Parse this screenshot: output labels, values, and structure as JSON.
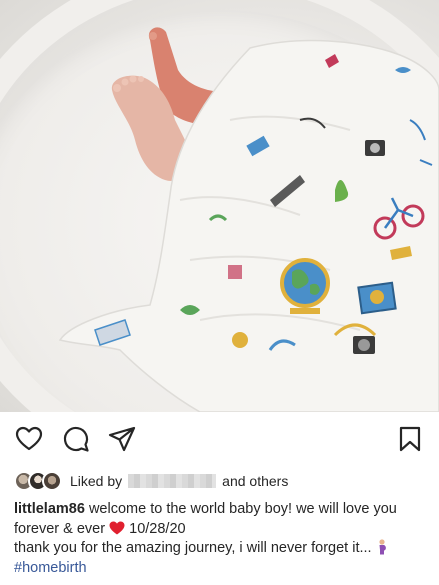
{
  "post": {
    "liked_by_prefix": "Liked by",
    "liked_by_suffix": "and others",
    "username": "littlelam86",
    "caption_part1": "welcome to the world baby boy! we will love you forever & ever",
    "caption_date": "10/28/20",
    "caption_part2": "thank you for the amazing journey, i will never forget it...",
    "hashtag": "#homebirth"
  },
  "icons": {
    "like": "heart-outline-icon",
    "comment": "comment-bubble-icon",
    "share": "paper-plane-icon",
    "save": "bookmark-icon",
    "heart_emoji": "red-heart-emoji",
    "person_emoji": "pregnant-woman-emoji"
  },
  "colors": {
    "text": "#262626",
    "hashtag": "#385898",
    "heart": "#e0202f"
  }
}
